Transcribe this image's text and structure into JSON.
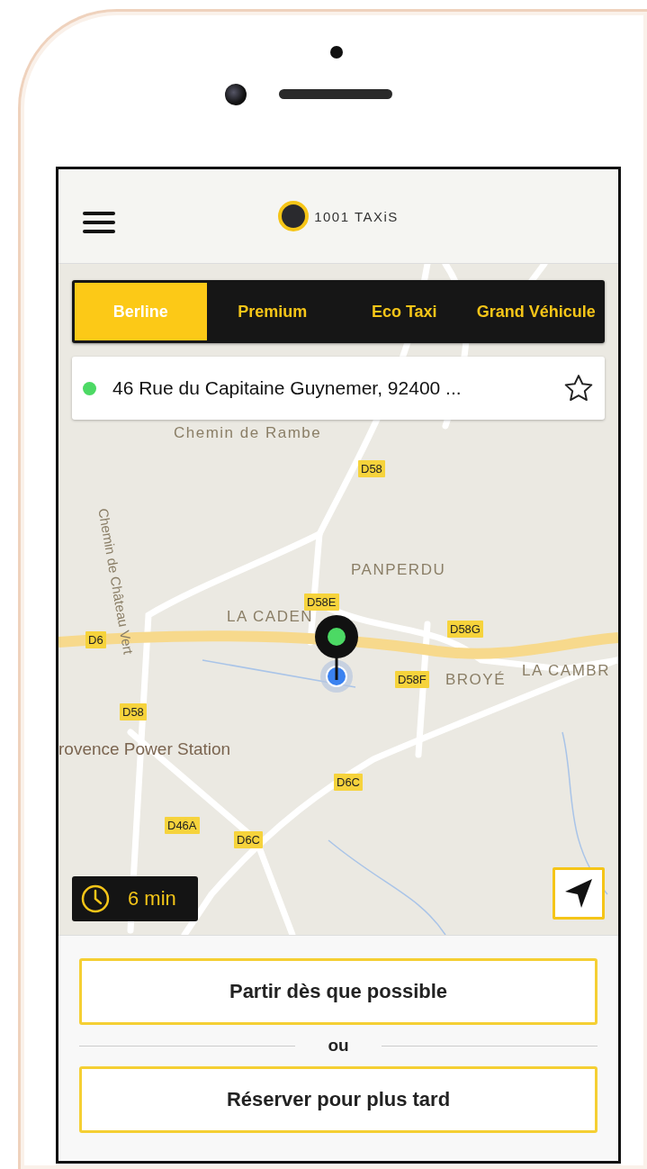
{
  "header": {
    "logo_text": "1001 TAXiS"
  },
  "tabs": [
    {
      "label": "Berline",
      "selected": true
    },
    {
      "label": "Premium",
      "selected": false
    },
    {
      "label": "Eco Taxi",
      "selected": false
    },
    {
      "label": "Grand Véhicule",
      "selected": false
    }
  ],
  "address": {
    "text": "46 Rue du Capitaine Guynemer, 92400 ...",
    "color": "#4cd964",
    "favorite": false
  },
  "map_labels": [
    {
      "kind": "place",
      "text": "Chemin de Rambe"
    },
    {
      "kind": "road",
      "text": "D58"
    },
    {
      "kind": "place",
      "text": "PANPERDU"
    },
    {
      "kind": "road",
      "text": "D58E"
    },
    {
      "kind": "place",
      "text": "LA CADEN"
    },
    {
      "kind": "road",
      "text": "D6"
    },
    {
      "kind": "road",
      "text": "D58G"
    },
    {
      "kind": "place",
      "text": "LA CAMBR"
    },
    {
      "kind": "road",
      "text": "D58F"
    },
    {
      "kind": "place",
      "text": "BROYÉ"
    },
    {
      "kind": "road",
      "text": "D58"
    },
    {
      "kind": "poi",
      "text": "rovence Power Station"
    },
    {
      "kind": "road",
      "text": "D6C"
    },
    {
      "kind": "road",
      "text": "D46A"
    },
    {
      "kind": "road",
      "text": "D6C"
    },
    {
      "kind": "place",
      "text": "Chemin de Château Vert"
    }
  ],
  "eta": "6 min",
  "actions": [
    {
      "label": "Partir dès que possible"
    },
    {
      "label": "Réserver pour plus tard"
    }
  ],
  "separator": "ou"
}
